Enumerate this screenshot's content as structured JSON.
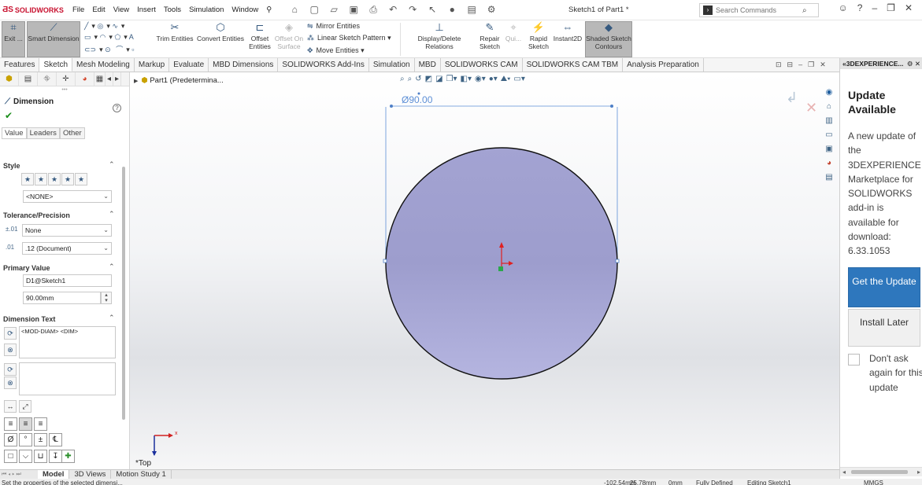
{
  "app": {
    "brand": "SOLIDWORKS",
    "doc_title": "Sketch1 of Part1 *"
  },
  "menus": [
    "File",
    "Edit",
    "View",
    "Insert",
    "Tools",
    "Simulation",
    "Window"
  ],
  "search": {
    "placeholder": "Search Commands"
  },
  "commands": {
    "exit_sketch": "Exit ...",
    "smart_dimension": "Smart Dimension",
    "trim": "Trim Entities",
    "convert": "Convert Entities",
    "offset": "Offset Entities",
    "offset_surface": "Offset On Surface",
    "mirror": "Mirror Entities",
    "linear_pattern": "Linear Sketch Pattern",
    "move": "Move Entities",
    "relations": "Display/Delete Relations",
    "repair": "Repair Sketch",
    "quick": "Qui...",
    "rapid": "Rapid Sketch",
    "instant2d": "Instant2D",
    "shaded": "Shaded Sketch Contours"
  },
  "tabs": [
    "Features",
    "Sketch",
    "Mesh Modeling",
    "Markup",
    "Evaluate",
    "MBD Dimensions",
    "SOLIDWORKS Add-Ins",
    "Simulation",
    "MBD",
    "SOLIDWORKS CAM",
    "SOLIDWORKS CAM TBM",
    "Analysis Preparation"
  ],
  "active_tab": "Sketch",
  "property_manager": {
    "title": "Dimension",
    "subtabs": [
      "Value",
      "Leaders",
      "Other"
    ],
    "style": {
      "header": "Style",
      "value": "<NONE>"
    },
    "tolerance": {
      "header": "Tolerance/Precision",
      "tolerance_value": "None",
      "precision_value": ".12 (Document)"
    },
    "primary": {
      "header": "Primary Value",
      "name": "D1@Sketch1",
      "value": "90.00mm"
    },
    "dim_text": {
      "header": "Dimension Text",
      "text": "<MOD-DIAM> <DIM>"
    }
  },
  "tree": {
    "item": "Part1 (Predetermina..."
  },
  "sketch": {
    "dimension_label": "Ø90.00",
    "view_label": "*Top",
    "x_axis": "x",
    "y_axis": "Y"
  },
  "colors": {
    "circle_fill": "#a9a9d6",
    "accent_blue": "#2e77bd",
    "brand_red": "#c8102e"
  },
  "right_pane": {
    "title": "3DEXPERIENCE...",
    "heading": "Update Available",
    "message": "A new update of the 3DEXPERIENCE Marketplace for SOLIDWORKS add-in is available for download: 6.33.1053",
    "primary_button": "Get the Update",
    "secondary_button": "Install Later",
    "checkbox_label": "Don't ask again for this update"
  },
  "bottom_tabs": [
    "Model",
    "3D Views",
    "Motion Study 1"
  ],
  "status": {
    "hint": "Set the properties of the selected dimensi...",
    "x": "-102.54mm",
    "y": "25.78mm",
    "z": "0mm",
    "state": "Fully Defined",
    "mode": "Editing Sketch1",
    "units": "MMGS"
  }
}
